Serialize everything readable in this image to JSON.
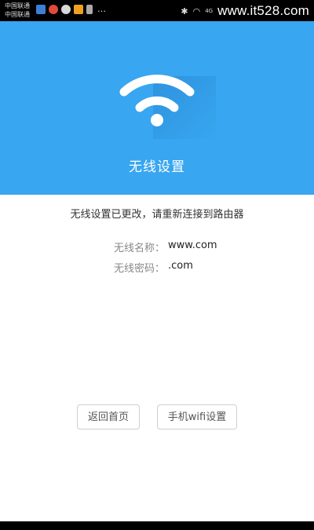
{
  "status_bar": {
    "carrier_1": "中国联通",
    "carrier_2": "中国联通",
    "more": "…",
    "signal_text": "4G",
    "watermark": "www.it528.com"
  },
  "header": {
    "icon": "wifi-icon",
    "title": "无线设置",
    "background": "#38a6f0"
  },
  "content": {
    "message": "无线设置已更改，请重新连接到路由器",
    "wifi_name_label": "无线名称：",
    "wifi_name_value": "www.com",
    "wifi_password_label": "无线密码：",
    "wifi_password_value": ".com"
  },
  "actions": {
    "back_label": "返回首页",
    "wifi_settings_label": "手机wifi设置"
  }
}
